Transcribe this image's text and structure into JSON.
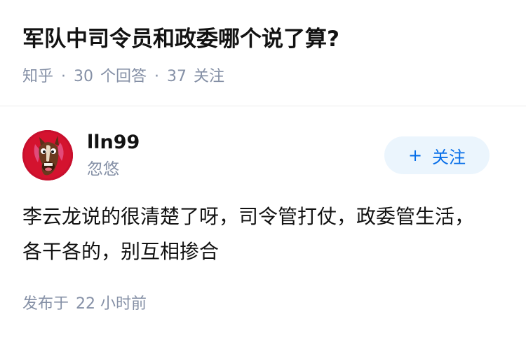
{
  "question": {
    "title": "军队中司令员和政委哪个说了算?",
    "meta": {
      "source": "知乎",
      "separator": "·",
      "answers_count": "30",
      "answers_label": "个回答",
      "followers_count": "37",
      "followers_label": "关注"
    }
  },
  "answer": {
    "author": {
      "name": "lln99",
      "bio": "忽悠",
      "avatar_icon": "horse-avatar-icon"
    },
    "follow_button": {
      "icon": "+",
      "label": "关注"
    },
    "content": "李云龙说的很清楚了呀，司令管打仗，政委管生活，各干各的，别互相掺合",
    "time": {
      "label": "发布于",
      "value": "22 小时前"
    }
  },
  "colors": {
    "text_primary": "#121212",
    "text_secondary": "#8590a6",
    "accent": "#056de8",
    "follow_bg": "#ebf5fd",
    "divider": "#ebebeb",
    "avatar_bg": "#c8102e"
  }
}
